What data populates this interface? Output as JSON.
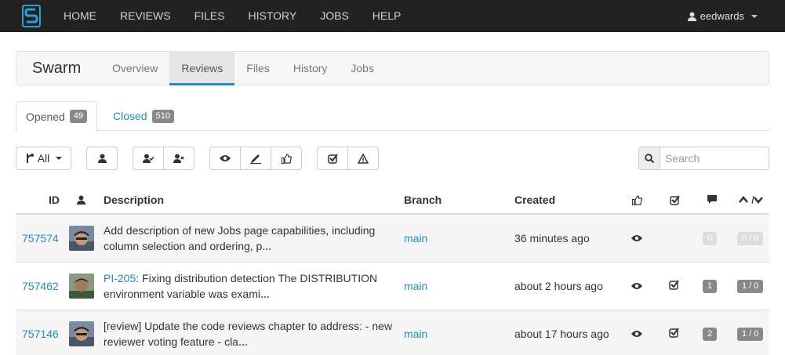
{
  "topnav": {
    "items": [
      "HOME",
      "REVIEWS",
      "FILES",
      "HISTORY",
      "JOBS",
      "HELP"
    ],
    "user": "eedwards"
  },
  "project": {
    "name": "Swarm",
    "tabs": [
      "Overview",
      "Reviews",
      "Files",
      "History",
      "Jobs"
    ],
    "active_tab": "Reviews"
  },
  "review_tabs": {
    "opened_label": "Opened",
    "opened_count": "49",
    "closed_label": "Closed",
    "closed_count": "510"
  },
  "toolbar": {
    "branch_filter_label": "All",
    "search_placeholder": "Search"
  },
  "table": {
    "headers": {
      "id": "ID",
      "description": "Description",
      "branch": "Branch",
      "created": "Created"
    },
    "rows": [
      {
        "id": "757574",
        "description": "Add description of new Jobs page capabilities, including column selection and ordering, p",
        "more": "...",
        "branch": "main",
        "created": "36 minutes ago",
        "comments": "0",
        "votes": "0 / 0"
      },
      {
        "id": "757462",
        "job_link": "PI-205",
        "description": ": Fixing distribution detection The DISTRIBUTION environment variable was exami",
        "more": "...",
        "branch": "main",
        "created": "about 2 hours ago",
        "comments": "1",
        "votes": "1 / 0"
      },
      {
        "id": "757146",
        "description": "[review] Update the code reviews chapter to address: - new reviewer voting feature - cla",
        "more": "...",
        "branch": "main",
        "created": "about 17 hours ago",
        "comments": "2",
        "votes": "1 / 0"
      }
    ]
  },
  "colors": {
    "link": "#1f8bd1",
    "navbar": "#222222",
    "badge": "#888888"
  }
}
